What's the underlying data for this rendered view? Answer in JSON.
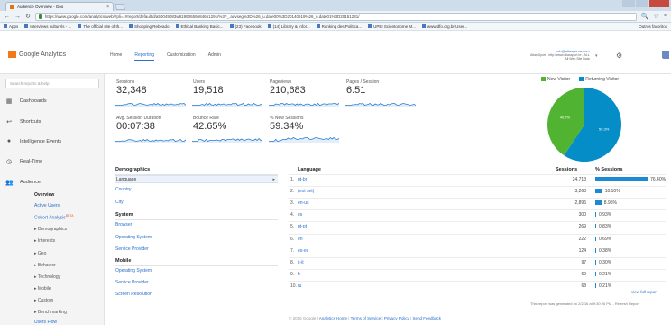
{
  "browser": {
    "tab_title": "Audience Overview - Goo",
    "url": "https://www.google.com/analytics/web/?pli=1#report/defaultid/a50049083w81950659p84651291/%3F_.advseg%3D%26_u.date00%3D20140619%26_u.date01%3D20151231/",
    "bookmarks": [
      "Apps",
      "Interviews culturels - ...",
      "The official site of th...",
      "Shopping Rebeado",
      "Ethical Banking Basic...",
      "(23) Facebook",
      "(14) Library & Infor...",
      "Ranking des Politica...",
      "UPEI Scientonome M...",
      "www.dfo.org.br/User..."
    ],
    "other_bookmarks": "Outros favoritos"
  },
  "header": {
    "logo": "Google Analytics",
    "nav": [
      "Home",
      "Reporting",
      "Customization",
      "Admin"
    ],
    "account_line1": "Atlas Sport - http://www.atlassport.br - ALL",
    "account_line2": "All Web Site Data",
    "account_email": "bob@atlasgama.com"
  },
  "sidebar": {
    "search_placeholder": "Search reports & help",
    "sections": [
      "Dashboards",
      "Shortcuts",
      "Intelligence Events",
      "Real-Time",
      "Audience"
    ],
    "items": [
      "Overview",
      "Active Users",
      "Cohort Analysis",
      "Demographics",
      "Interests",
      "Geo",
      "Behavior",
      "Technology",
      "Mobile",
      "Custom",
      "Benchmarking",
      "Users Flow"
    ],
    "beta_tag": "BETA"
  },
  "metrics": [
    {
      "label": "Sessions",
      "value": "32,348"
    },
    {
      "label": "Users",
      "value": "19,518"
    },
    {
      "label": "Pageviews",
      "value": "210,683"
    },
    {
      "label": "Pages / Session",
      "value": "6.51"
    },
    {
      "label": "Avg. Session Duration",
      "value": "00:07:38"
    },
    {
      "label": "Bounce Rate",
      "value": "42.65%"
    },
    {
      "label": "% New Sessions",
      "value": "59.34%"
    }
  ],
  "pie": {
    "legend": [
      "New Visitor",
      "Returning Visitor"
    ],
    "new_pct": 40.7,
    "returning_pct": 59.3,
    "labels": [
      "40.7%",
      "59.3%"
    ],
    "colors": {
      "new": "#50b432",
      "returning": "#058dc7"
    }
  },
  "demographics": {
    "title": "Demographics",
    "rows": [
      "Language",
      "Country",
      "City"
    ],
    "system_title": "System",
    "system_rows": [
      "Browser",
      "Operating System",
      "Service Provider"
    ],
    "mobile_title": "Mobile",
    "mobile_rows": [
      "Operating System",
      "Service Provider",
      "Screen Resolution"
    ]
  },
  "table": {
    "col_language": "Language",
    "col_sessions": "Sessions",
    "col_pct": "% Sessions",
    "rows": [
      {
        "num": "1.",
        "lang": "pt-br",
        "sessions": "24,713",
        "pct": "76.40%",
        "fraction": 0.764
      },
      {
        "num": "2.",
        "lang": "(not set)",
        "sessions": "3,268",
        "pct": "10.10%",
        "fraction": 0.101
      },
      {
        "num": "3.",
        "lang": "en-us",
        "sessions": "2,896",
        "pct": "8.95%",
        "fraction": 0.0895
      },
      {
        "num": "4.",
        "lang": "es",
        "sessions": "300",
        "pct": "0.93%",
        "fraction": 0.0093
      },
      {
        "num": "5.",
        "lang": "pt-pt",
        "sessions": "269",
        "pct": "0.83%",
        "fraction": 0.0083
      },
      {
        "num": "6.",
        "lang": "en",
        "sessions": "222",
        "pct": "0.69%",
        "fraction": 0.0069
      },
      {
        "num": "7.",
        "lang": "es-es",
        "sessions": "124",
        "pct": "0.38%",
        "fraction": 0.0038
      },
      {
        "num": "8.",
        "lang": "it-it",
        "sessions": "97",
        "pct": "0.30%",
        "fraction": 0.003
      },
      {
        "num": "9.",
        "lang": "fr",
        "sessions": "69",
        "pct": "0.21%",
        "fraction": 0.0021
      },
      {
        "num": "10.",
        "lang": "ru",
        "sessions": "68",
        "pct": "0.21%",
        "fraction": 0.0021
      }
    ],
    "view_full": "view full report",
    "generated": "This report was generated on 2/2/16 at 9:30:26 PM - Refresh Report"
  },
  "footer": {
    "copyright": "© 2016 Google",
    "links": [
      "Analytics Home",
      "Terms of Service",
      "Privacy Policy",
      "Send Feedback"
    ]
  }
}
